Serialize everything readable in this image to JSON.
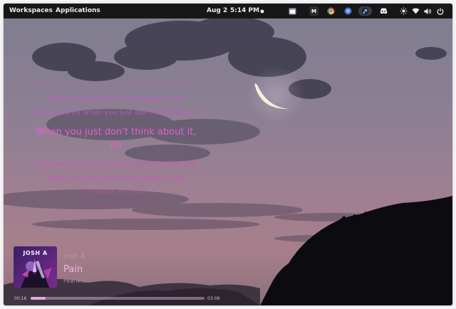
{
  "topbar": {
    "workspaces": "Workspaces",
    "applications": "Applications",
    "date": "Aug 2",
    "time": "5:14 PM",
    "tray_icons": [
      "record-dot-icon",
      "window-icon",
      "gmail-icon",
      "chrome-icon",
      "browser-icon",
      "steam-icon",
      "discord-icon",
      "brightness-icon",
      "wifi-icon",
      "volume-icon",
      "power-icon"
    ],
    "gmail_letter": "M"
  },
  "lyrics": {
    "lines": [
      "Pain goes by when you just don't think about",
      "When you just don't think about it, no",
      "Pain goes by when you just don't think about",
      "When you just don't think about it, no",
      "Pain goes by when you just don't think about",
      "When you just don't think about it, no",
      "Oh-whoa, oh-whoa",
      "Oh-whoa, oh-whoa"
    ],
    "color": "#d44fc6"
  },
  "player": {
    "art_text": "JOSH A",
    "artist": "Josh A",
    "title": "Pain",
    "album": "Fearless",
    "elapsed": "00:16",
    "duration": "03:08",
    "progress": 0.085
  }
}
